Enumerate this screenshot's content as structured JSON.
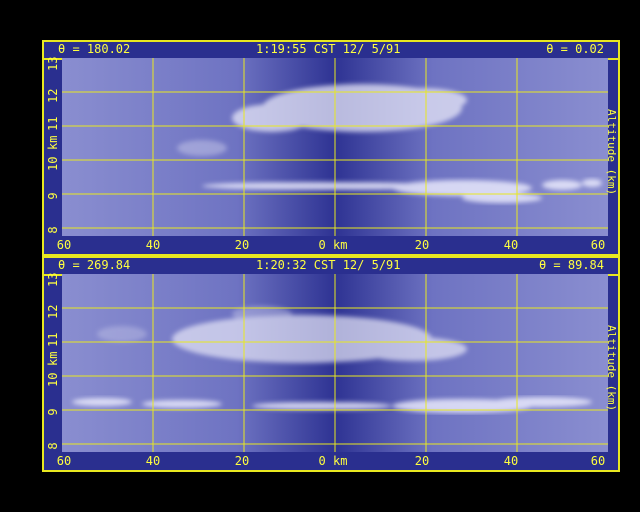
{
  "panels": [
    {
      "theta_left": "θ = 180.02",
      "timestamp": "1:19:55 CST 12/ 5/91",
      "theta_right": "θ = 0.02",
      "y_ticks": [
        "8",
        "9",
        "10",
        "11",
        "12",
        "13"
      ],
      "y_unit_left": "km",
      "y_label_right": "Altitude (km)",
      "x_ticks": [
        "60",
        "40",
        "20",
        "0 km",
        "20",
        "40",
        "60"
      ]
    },
    {
      "theta_left": "θ = 269.84",
      "timestamp": "1:20:32 CST 12/ 5/91",
      "theta_right": "θ = 89.84",
      "y_ticks": [
        "8",
        "9",
        "10",
        "11",
        "12",
        "13"
      ],
      "y_unit_left": "km",
      "y_label_right": "Altitude (km)",
      "x_ticks": [
        "60",
        "40",
        "20",
        "0 km",
        "20",
        "40",
        "60"
      ]
    }
  ],
  "colors": {
    "border": "#e8e820",
    "background": "#2a2f8f",
    "text": "#ffff40"
  }
}
